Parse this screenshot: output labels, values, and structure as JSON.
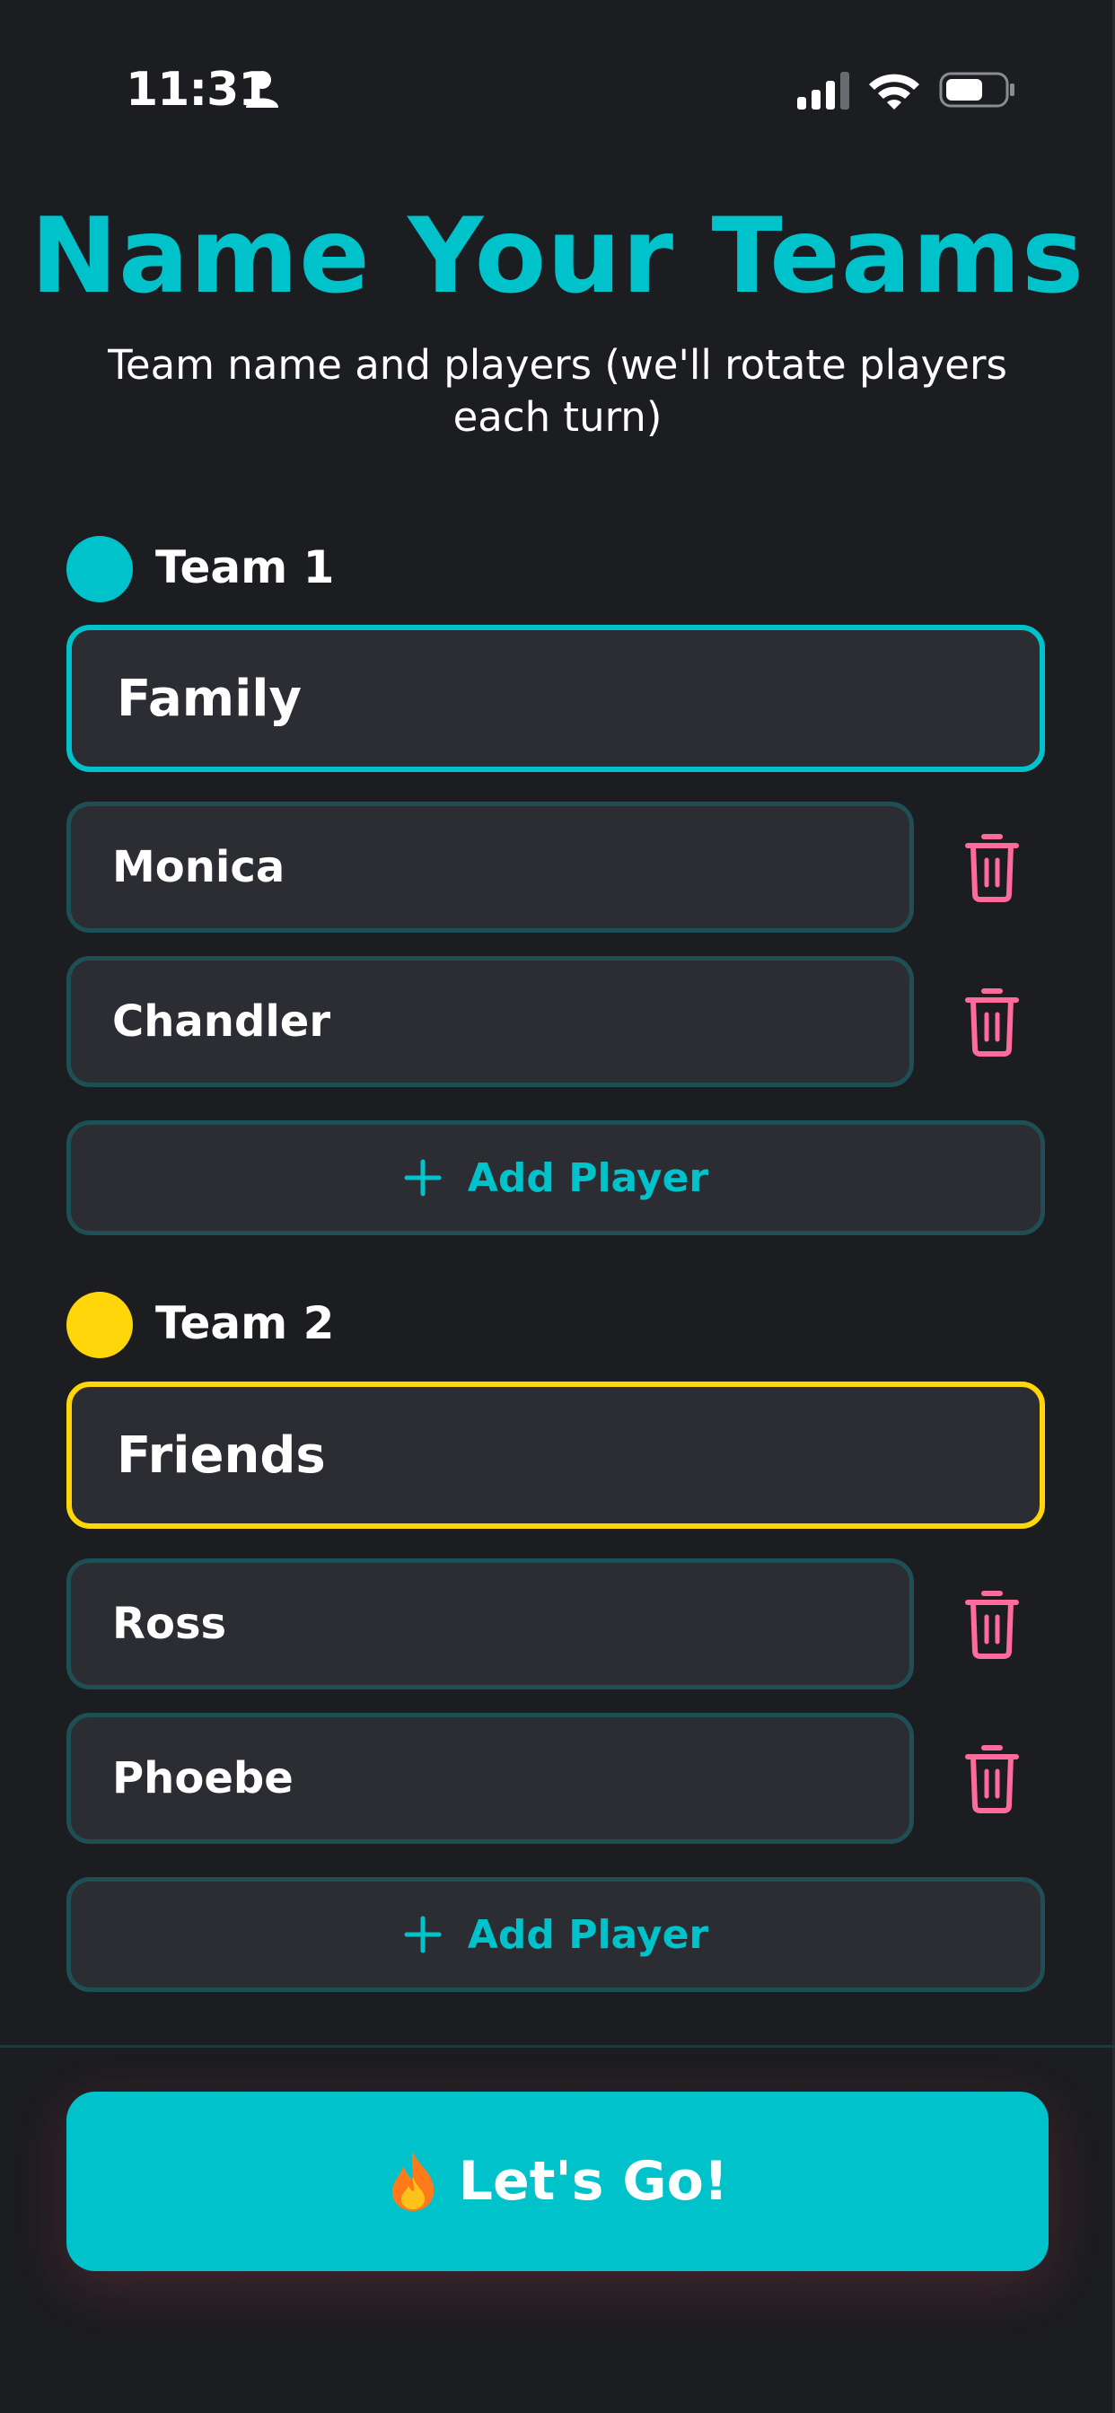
{
  "status_bar": {
    "time": "11:31",
    "icons": [
      "person-icon",
      "cellular-signal-icon",
      "wifi-icon",
      "battery-icon"
    ]
  },
  "header": {
    "title": "Name Your Teams",
    "subtitle": "Team name and players (we'll rotate players each turn)"
  },
  "teams": [
    {
      "label": "Team 1",
      "color": "#00c2cb",
      "name": "Family",
      "players": [
        "Monica",
        "Chandler"
      ],
      "add_player_label": "Add Player"
    },
    {
      "label": "Team 2",
      "color": "#ffd60a",
      "name": "Friends",
      "players": [
        "Ross",
        "Phoebe"
      ],
      "add_player_label": "Add Player"
    }
  ],
  "footer": {
    "go_label": "Let's Go!",
    "go_icon": "fire-icon"
  },
  "colors": {
    "accent": "#00c2cb",
    "team2": "#ffd60a",
    "delete": "#ff6b9a",
    "background": "#1c1d21",
    "field": "#2c2d32"
  }
}
